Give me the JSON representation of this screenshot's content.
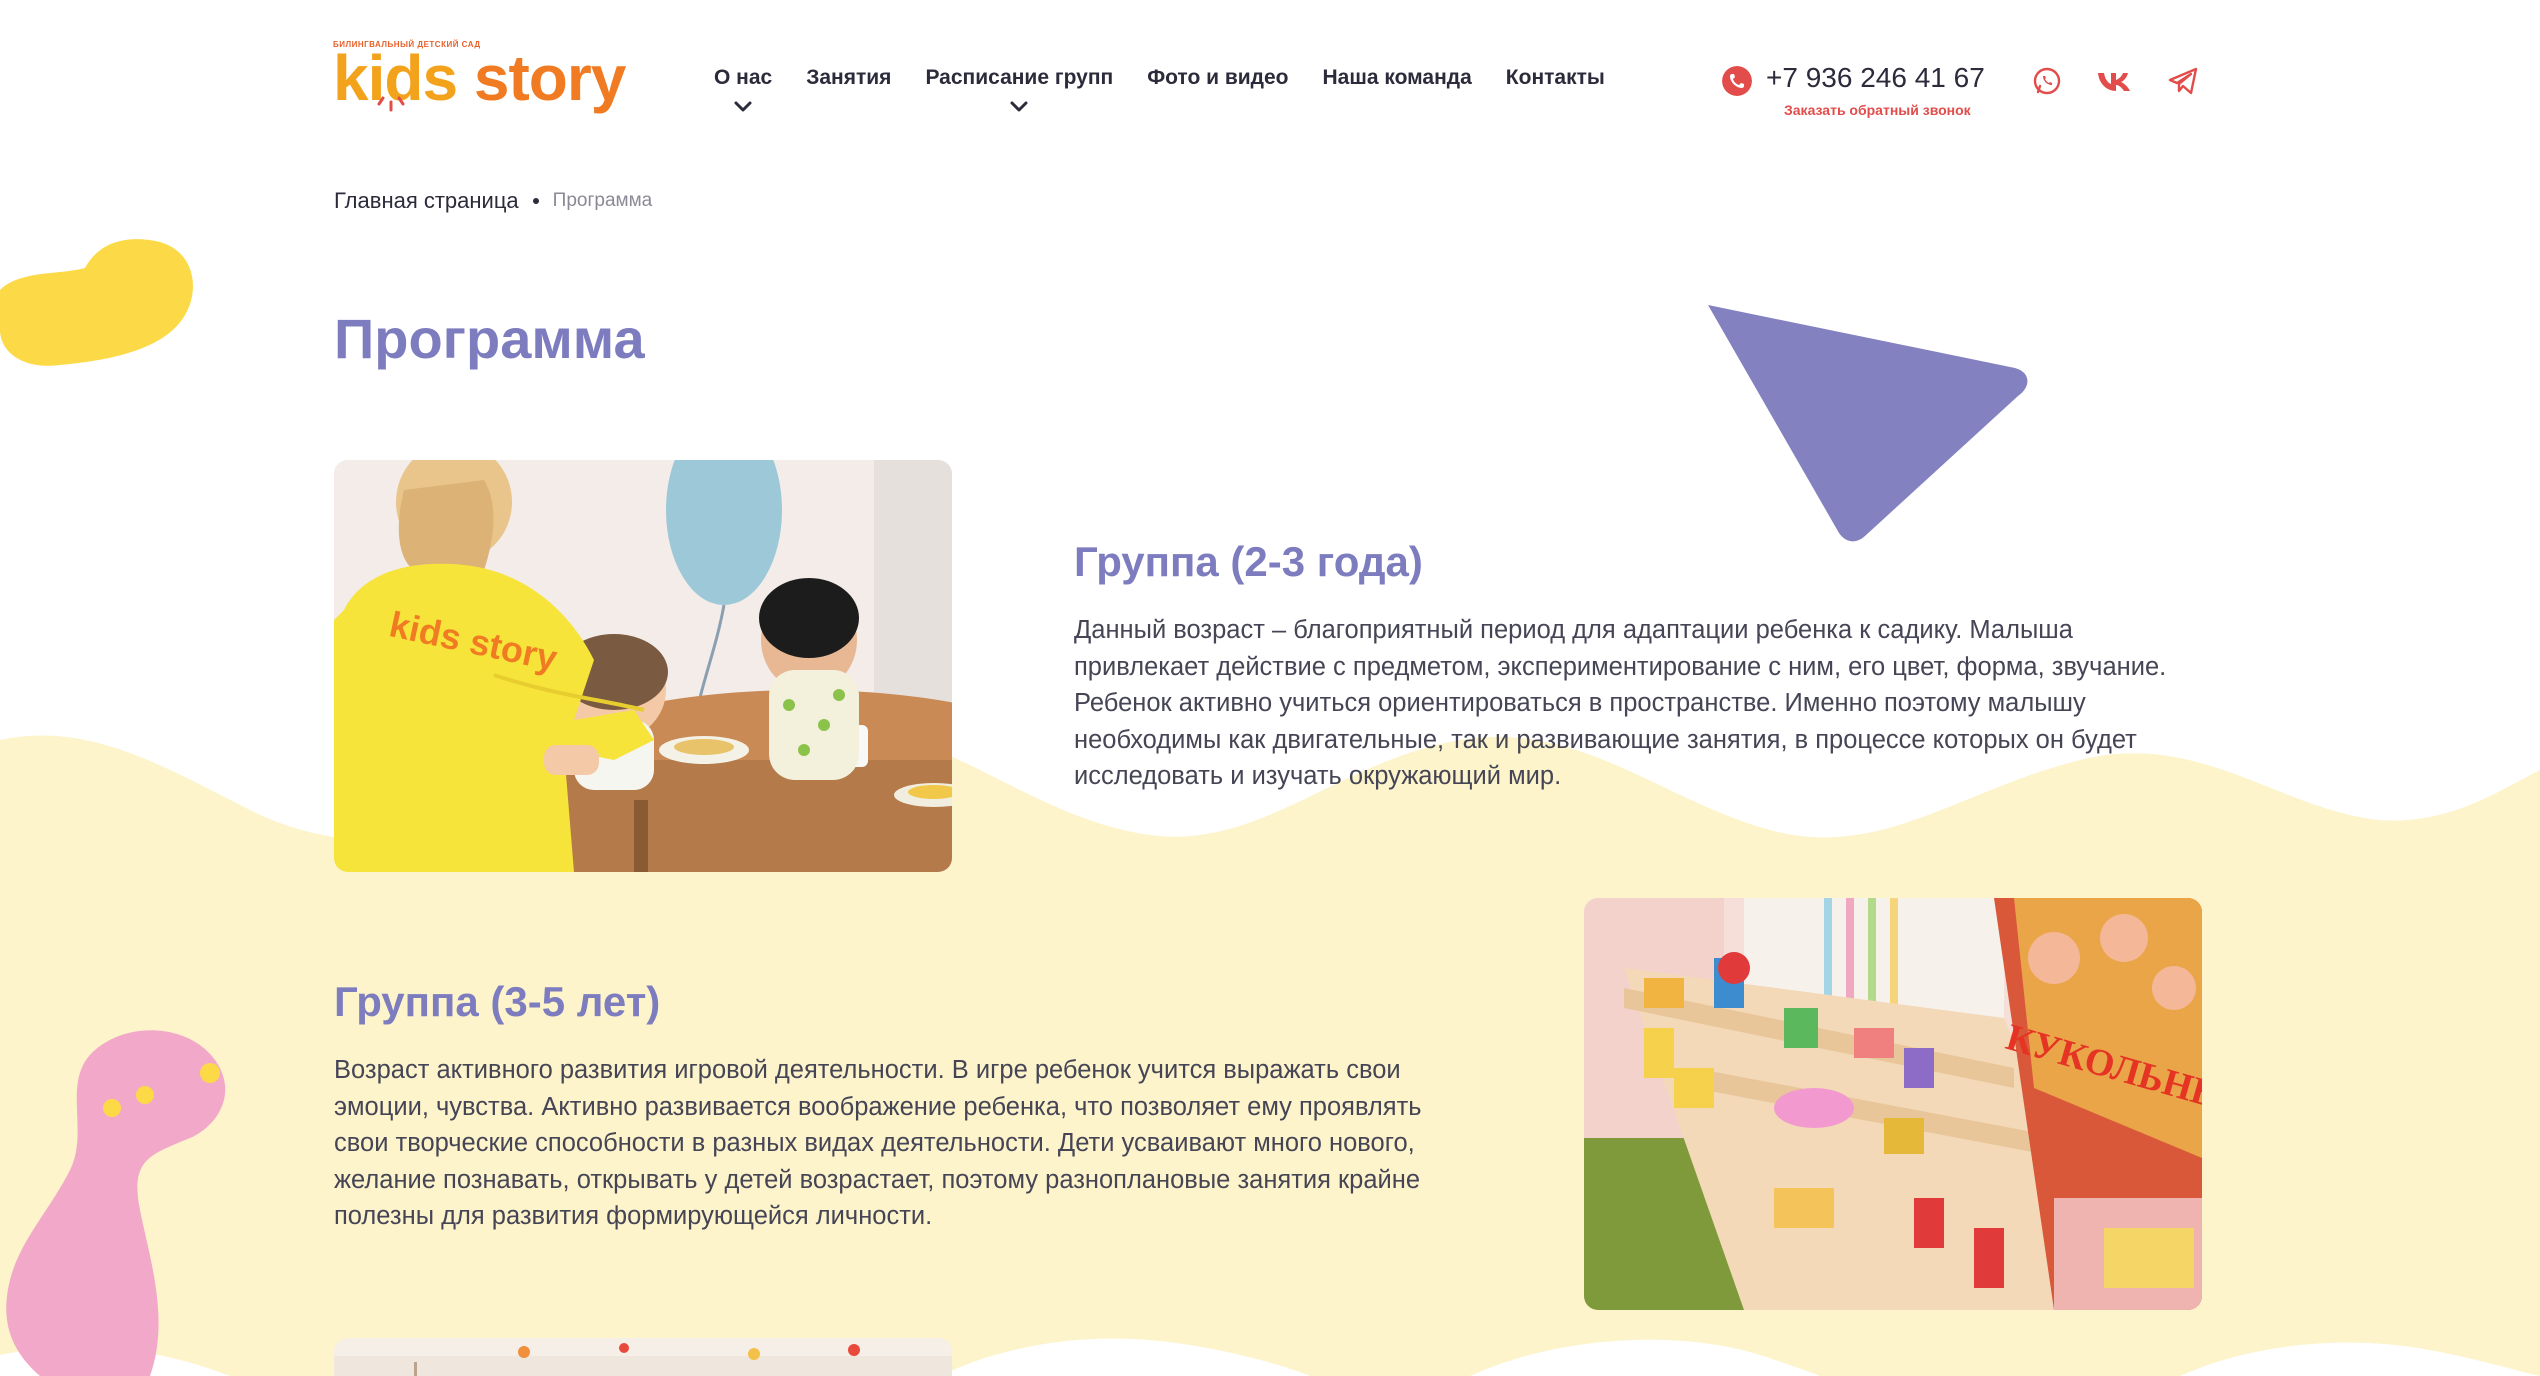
{
  "colors": {
    "accent_purple": "#7c7cbf",
    "wave_yellow": "#fdf4cc",
    "blob_yellow": "#fcd947",
    "blob_pink": "#f2a8c8",
    "triangle_purple": "#8381c0",
    "phone_red": "#e24c4b",
    "logo_orange": "#f07b22",
    "logo_yellow": "#f3a21b"
  },
  "header": {
    "logo": {
      "tagline": "Билингвальный детский сад",
      "kids": "kids",
      "story": "story"
    },
    "nav": [
      {
        "label": "О нас",
        "has_dropdown": true
      },
      {
        "label": "Занятия",
        "has_dropdown": false
      },
      {
        "label": "Расписание групп",
        "has_dropdown": true
      },
      {
        "label": "Фото и видео",
        "has_dropdown": false
      },
      {
        "label": "Наша команда",
        "has_dropdown": false
      },
      {
        "label": "Контакты",
        "has_dropdown": false
      }
    ],
    "phone": "+7 936 246 41 67",
    "callback": "Заказать обратный звонок",
    "social": [
      "whatsapp-icon",
      "vk-icon",
      "telegram-icon"
    ]
  },
  "breadcrumb": {
    "home": "Главная страница",
    "current": "Программа"
  },
  "page_title": "Программа",
  "sections": [
    {
      "title": "Группа (2-3 года)",
      "text": "Данный возраст – благоприятный период для адаптации ребенка к садику. Малыша привлекает действие с предметом, экспериментирование с ним, его цвет, форма, звучание. Ребенок активно учиться ориентироваться в пространстве. Именно поэтому малышу необходимы как двигательные, так и развивающие занятия, в процессе которых он будет исследовать и изучать окружающий мир.",
      "photo_caption": "kids story"
    },
    {
      "title": "Группа (3-5 лет)",
      "text": "Возраст активного развития игровой деятельности. В игре ребенок учится выражать свои эмоции, чувства. Активно развивается воображение ребенка, что позволяет ему проявлять свои творческие способности в разных видах деятельности. Дети усваивают много нового, желание познавать, открывать у детей возрастает, поэтому разноплановые занятия крайне полезны для развития формирующейся личности.",
      "photo_caption": "КУКОЛЬНЫЙ ТЕАТР"
    }
  ]
}
